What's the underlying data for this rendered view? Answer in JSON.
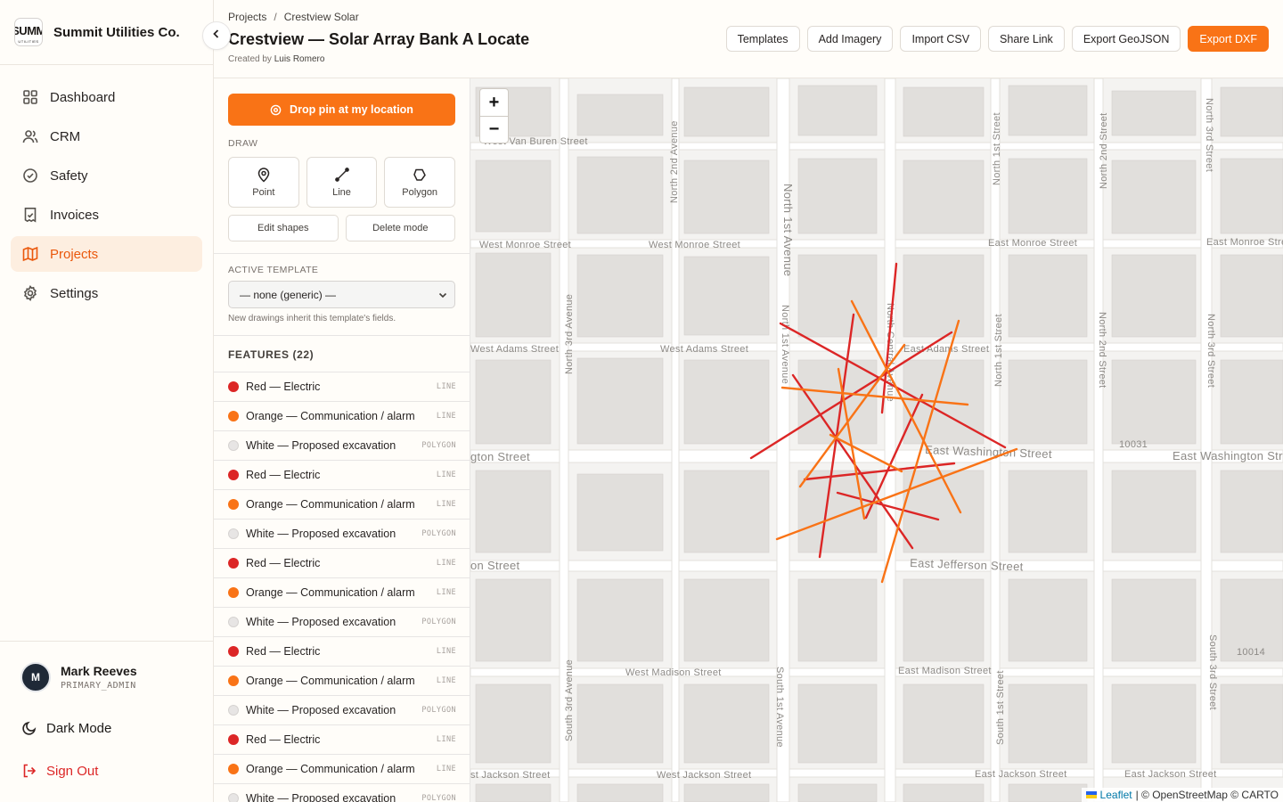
{
  "brand": {
    "name": "Summit Utilities Co.",
    "logo_text": "SUMM",
    "logo_subtext": "UTILITIES"
  },
  "nav": {
    "items": [
      {
        "label": "Dashboard",
        "icon": "grid-icon"
      },
      {
        "label": "CRM",
        "icon": "users-icon"
      },
      {
        "label": "Safety",
        "icon": "check-circle-icon"
      },
      {
        "label": "Invoices",
        "icon": "receipt-icon"
      },
      {
        "label": "Projects",
        "icon": "map-icon",
        "active": true
      },
      {
        "label": "Settings",
        "icon": "gear-icon"
      }
    ]
  },
  "user": {
    "initial": "M",
    "name": "Mark Reeves",
    "role": "PRIMARY_ADMIN"
  },
  "footer": {
    "dark_mode": "Dark Mode",
    "sign_out": "Sign Out"
  },
  "header": {
    "breadcrumb": [
      "Projects",
      "Crestview Solar"
    ],
    "breadcrumb_sep": "/",
    "title": "Crestview — Solar Array Bank A Locate",
    "created_by_label": "Created by",
    "created_by": "Luis Romero",
    "actions": [
      "Templates",
      "Add Imagery",
      "Import CSV",
      "Share Link",
      "Export GeoJSON",
      "Export DXF"
    ]
  },
  "panel": {
    "drop_pin": "Drop pin at my location",
    "draw_label": "DRAW",
    "tools": [
      "Point",
      "Line",
      "Polygon"
    ],
    "edit_shapes": "Edit shapes",
    "delete_mode": "Delete mode",
    "template_label": "ACTIVE TEMPLATE",
    "template_value": "— none (generic) —",
    "template_hint": "New drawings inherit this template's fields.",
    "features_heading": "FEATURES (22)",
    "features": [
      {
        "name": "Red — Electric",
        "type": "LINE",
        "color": "#dc2626"
      },
      {
        "name": "Orange — Communication / alarm",
        "type": "LINE",
        "color": "#f97316"
      },
      {
        "name": "White — Proposed excavation",
        "type": "POLYGON",
        "color": "#e7e5e4"
      },
      {
        "name": "Red — Electric",
        "type": "LINE",
        "color": "#dc2626"
      },
      {
        "name": "Orange — Communication / alarm",
        "type": "LINE",
        "color": "#f97316"
      },
      {
        "name": "White — Proposed excavation",
        "type": "POLYGON",
        "color": "#e7e5e4"
      },
      {
        "name": "Red — Electric",
        "type": "LINE",
        "color": "#dc2626"
      },
      {
        "name": "Orange — Communication / alarm",
        "type": "LINE",
        "color": "#f97316"
      },
      {
        "name": "White — Proposed excavation",
        "type": "POLYGON",
        "color": "#e7e5e4"
      },
      {
        "name": "Red — Electric",
        "type": "LINE",
        "color": "#dc2626"
      },
      {
        "name": "Orange — Communication / alarm",
        "type": "LINE",
        "color": "#f97316"
      },
      {
        "name": "White — Proposed excavation",
        "type": "POLYGON",
        "color": "#e7e5e4"
      },
      {
        "name": "Red — Electric",
        "type": "LINE",
        "color": "#dc2626"
      },
      {
        "name": "Orange — Communication / alarm",
        "type": "LINE",
        "color": "#f97316"
      },
      {
        "name": "White — Proposed excavation",
        "type": "POLYGON",
        "color": "#e7e5e4"
      }
    ]
  },
  "map": {
    "zoom_in": "+",
    "zoom_out": "−",
    "attribution_leaflet": "Leaflet",
    "attribution_rest": "| © OpenStreetMap © CARTO",
    "streets": {
      "w_van_buren": "West Van Buren Street",
      "n_2nd_ave": "North 2nd Avenue",
      "n_1st_ave": "North 1st Avenue",
      "n_1st_st": "North 1st Street",
      "n_2nd_st": "North 2nd Street",
      "n_3rd_st": "North 3rd Street",
      "n_3rd_ave": "North 3rd Avenue",
      "w_monroe_1": "West Monroe Street",
      "w_monroe_2": "West Monroe Street",
      "e_monroe_1": "East Monroe Street",
      "e_monroe_2": "East Monroe Stre",
      "w_adams_1": "West Adams Street",
      "w_adams_2": "West Adams Street",
      "e_adams": "East Adams Street",
      "n_central": "North Central Avenue",
      "w_washington": "gton Street",
      "e_washington_1": "East Washington Street",
      "e_washington_2": "East Washington Stre",
      "num_10031": "10031",
      "num_10014": "10014",
      "w_jefferson": "on Street",
      "e_jefferson": "East Jefferson Street",
      "w_madison": "West Madison Street",
      "e_madison": "East Madison Street",
      "s_3rd_ave": "South 3rd Avenue",
      "s_1st_ave": "South 1st Avenue",
      "s_1st_st": "South 1st Street",
      "s_3rd_st": "South 3rd Street",
      "w_jackson_1": "st Jackson Street",
      "w_jackson_2": "West Jackson Street",
      "e_jackson_1": "East Jackson Street",
      "e_jackson_2": "East Jackson Street"
    }
  }
}
